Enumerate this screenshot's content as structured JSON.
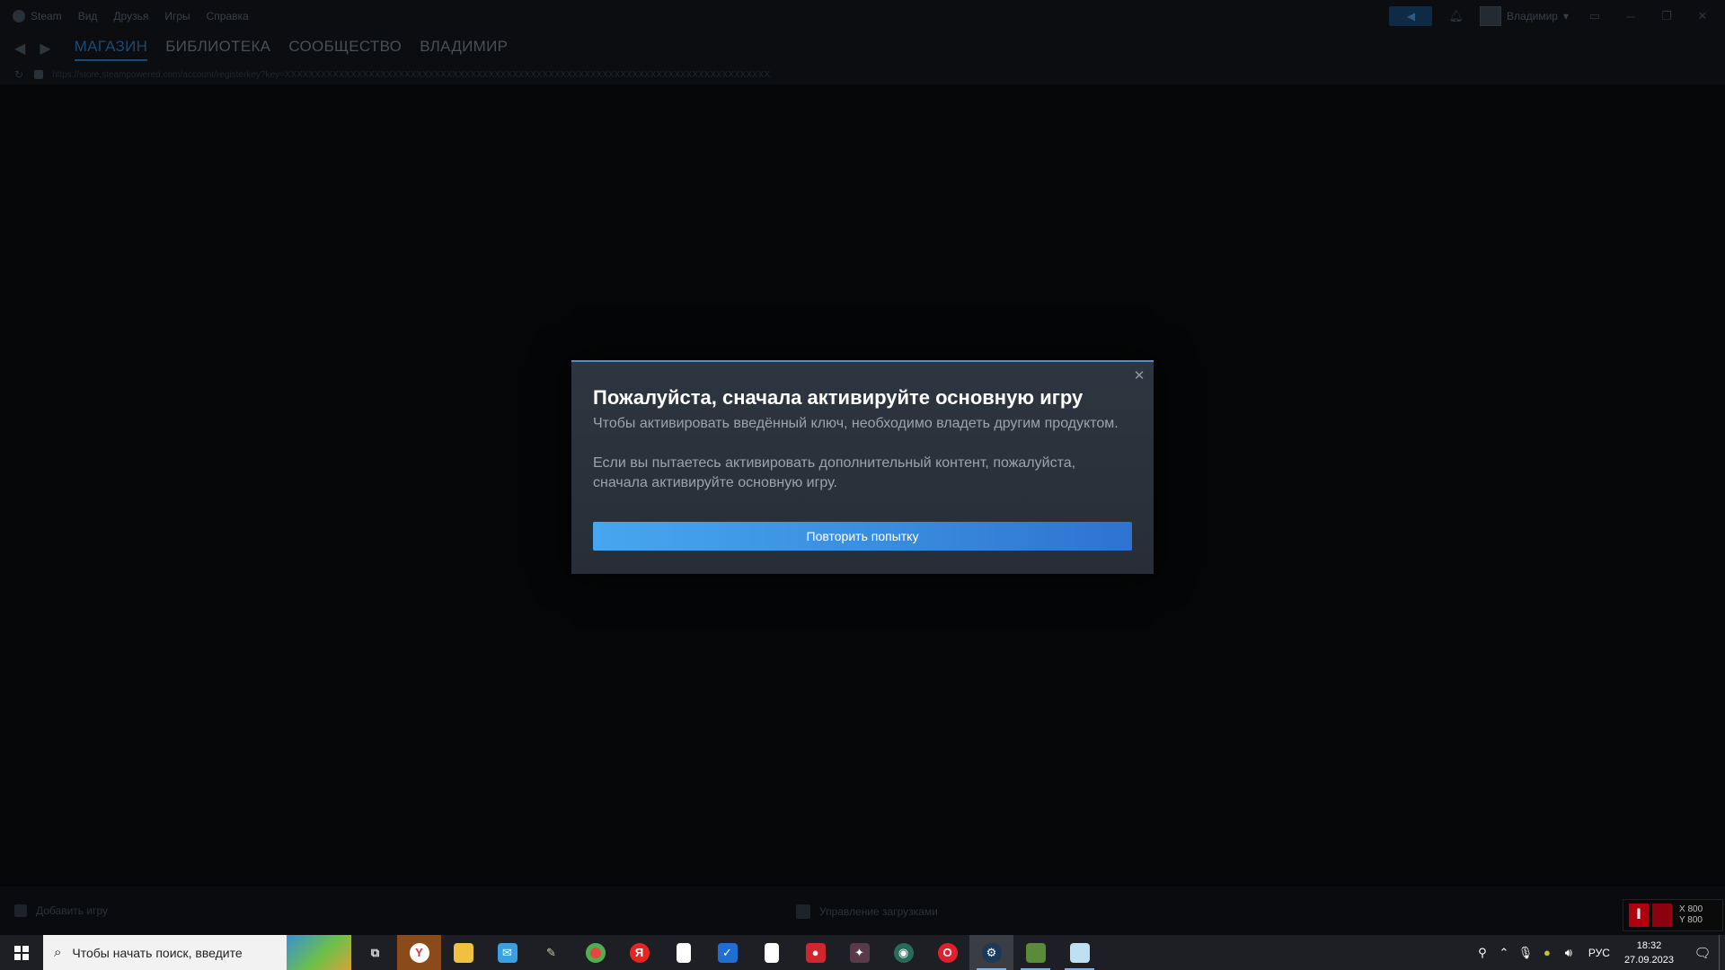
{
  "titlebar": {
    "menu": [
      "Steam",
      "Вид",
      "Друзья",
      "Игры",
      "Справка"
    ],
    "user_name": "Владимир",
    "window_controls": [
      "minimize-icon",
      "restore-icon",
      "close-icon"
    ]
  },
  "nav": {
    "tabs": [
      "МАГАЗИН",
      "БИБЛИОТЕКА",
      "СООБЩЕСТВО",
      "ВЛАДИМИР"
    ],
    "active_tab": "МАГАЗИН"
  },
  "urlbar": {
    "url": "https://store.steampowered.com/account/registerkey?key=XXXXXXXXXXXXXXXXXXXXXXXXXXXXXXXXXXXXXXXXXXXXXXXXXXXXXXXXXXXXXXXXXXXXXXXXXXXXXXXXXXXXXXX"
  },
  "dialog": {
    "title": "Пожалуйста, сначала активируйте основную игру",
    "subtitle": "Чтобы активировать введённый ключ, необходимо владеть другим продуктом.",
    "paragraph": "Если вы пытаетесь активировать дополнительный контент, пожалуйста, сначала активируйте основную игру.",
    "retry_label": "Повторить попытку",
    "close_symbol": "✕"
  },
  "bottombar": {
    "add_game": "Добавить игру",
    "downloads": "Управление загрузками"
  },
  "overlay_widget": {
    "x": "X 800",
    "y": "Y 800"
  },
  "taskbar": {
    "search_placeholder": "Чтобы начать поиск, введите",
    "language": "РУС",
    "time": "18:32",
    "date": "27.09.2023"
  }
}
